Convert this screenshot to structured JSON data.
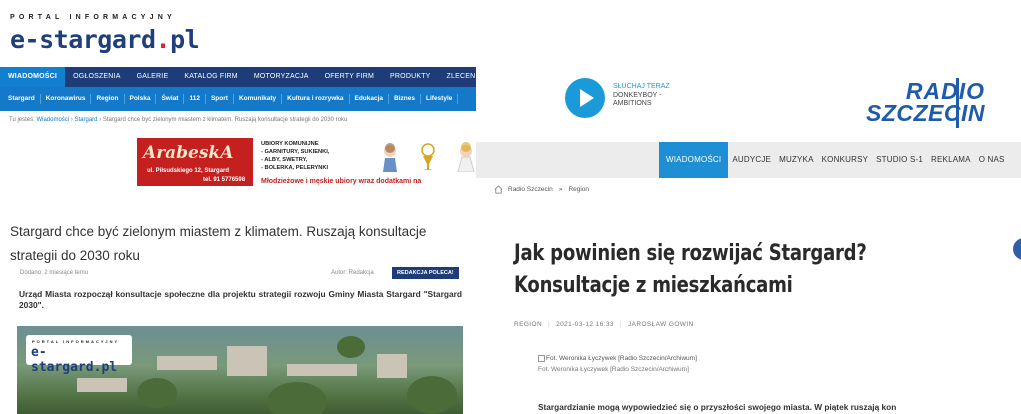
{
  "left": {
    "logo": {
      "portal": "PORTAL INFORMACYJNY",
      "name": "e-stargard",
      "dot": ".",
      "tld": "pl"
    },
    "main_nav": [
      "WIADOMOŚCI",
      "OGŁOSZENIA",
      "GALERIE",
      "KATALOG FIRM",
      "MOTORYZACJA",
      "OFERTY FIRM",
      "PRODUKTY",
      "ZLECEN"
    ],
    "sub_nav": [
      "Stargard",
      "Koronawirus",
      "Region",
      "Polska",
      "Świat",
      "112",
      "Sport",
      "Komunikaty",
      "Kultura i rozrywka",
      "Edukacja",
      "Biznes",
      "Lifestyle"
    ],
    "breadcrumb": {
      "prefix": "Tu jesteś:",
      "link1": "Wiadomości",
      "sep": "›",
      "link2": "Stargard",
      "current": "Stargard chce być zielonym miastem z klimatem. Ruszają konsultacje strategii do 2030 roku"
    },
    "ad": {
      "brand": "ArabeskA",
      "address": "ul. Piłsudskiego 12, Stargard",
      "phone": "tel. 91 5776598",
      "lines": [
        "UBIORY KOMUNIJNE",
        "- GARNITURY, SUKIENKI,",
        "- ALBY, SWETRY,",
        "- BOLERKA, PELERYNKI"
      ],
      "slogan": "Młodzieżowe i męskie ubiory wraz dodatkami na"
    },
    "article": {
      "title": "Stargard chce być zielonym miastem z klimatem. Ruszają konsultacje strategii do 2030 roku",
      "added": "Dodano: 2 miesiące temu",
      "author": "Autor: Redakcja",
      "badge": "REDAKCJA POLECA!",
      "lead": "Urząd Miasta rozpoczął konsultacje społeczne dla projektu strategii rozwoju Gminy Miasta Stargard \"Stargard 2030\".",
      "photo_logo_small": "PORTAL INFORMACYJNY",
      "photo_logo_big": "e-stargard.pl"
    }
  },
  "right": {
    "player": {
      "label": "SŁUCHAJ TERAZ",
      "track": "DONKEYBOY - AMBITIONS",
      "icon": "play-icon"
    },
    "logo": {
      "line1": "RADIO",
      "line2": "SZCZECIN"
    },
    "nav": [
      "WIADOMOŚCI",
      "AUDYCJE",
      "MUZYKA",
      "KONKURSY",
      "STUDIO S-1",
      "REKLAMA",
      "O NAS"
    ],
    "breadcrumb": {
      "home": "Radio Szczecin",
      "sep": "»",
      "current": "Region"
    },
    "article": {
      "title": "Jak powinien się rozwijać Stargard? Konsultacje z mieszkańcami",
      "category": "REGION",
      "datetime": "2021-03-12 16:33",
      "author": "JAROSŁAW GOWIN",
      "photo_caption": "Fot. Weronika Łyczywek [Radio Szczecin/Archiwum]",
      "photo_credit": "Fot. Weronika Łyczywek [Radio Szczecin/Archiwum]",
      "lead": "Stargardzianie mogą wypowiedzieć się o przyszłości swojego miasta. W piątek ruszają kon"
    }
  },
  "colors": {
    "estargard_nav": "#1d3c78",
    "estargard_subnav": "#1579c9",
    "radio_blue": "#1e5bab",
    "radio_nav_active": "#1e8fd4"
  }
}
